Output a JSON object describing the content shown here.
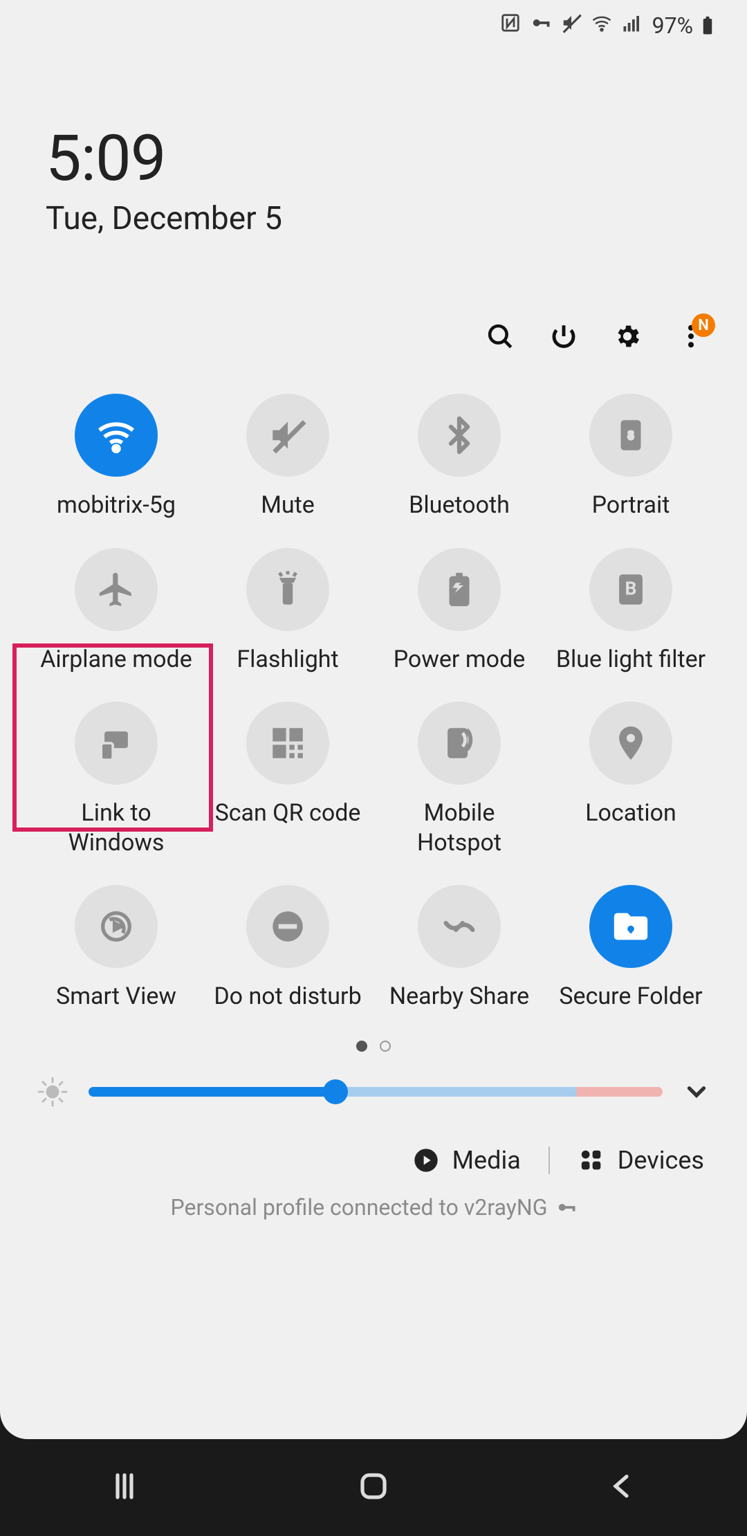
{
  "status": {
    "battery_pct": "97%",
    "icons": [
      "nfc",
      "vpn-key",
      "mute",
      "wifi",
      "signal",
      "battery"
    ]
  },
  "header": {
    "time": "5:09",
    "date": "Tue, December 5"
  },
  "actions": {
    "more_badge": "N"
  },
  "tiles": [
    {
      "id": "wifi",
      "label": "mobitrix-5g",
      "active": true
    },
    {
      "id": "mute",
      "label": "Mute",
      "active": false
    },
    {
      "id": "bluetooth",
      "label": "Bluetooth",
      "active": false
    },
    {
      "id": "portrait",
      "label": "Portrait",
      "active": false
    },
    {
      "id": "airplane",
      "label": "Airplane mode",
      "active": false,
      "highlighted": true
    },
    {
      "id": "flashlight",
      "label": "Flashlight",
      "active": false
    },
    {
      "id": "power-mode",
      "label": "Power mode",
      "active": false
    },
    {
      "id": "blue-light",
      "label": "Blue light filter",
      "active": false
    },
    {
      "id": "link-windows",
      "label": "Link to Windows",
      "active": false
    },
    {
      "id": "qr",
      "label": "Scan QR code",
      "active": false
    },
    {
      "id": "hotspot",
      "label": "Mobile Hotspot",
      "active": false
    },
    {
      "id": "location",
      "label": "Location",
      "active": false
    },
    {
      "id": "smart-view",
      "label": "Smart View",
      "active": false
    },
    {
      "id": "dnd",
      "label": "Do not disturb",
      "active": false
    },
    {
      "id": "nearby",
      "label": "Nearby Share",
      "active": false
    },
    {
      "id": "secure-folder",
      "label": "Secure Folder",
      "active": true
    }
  ],
  "pager": {
    "page_count": 2,
    "current": 0
  },
  "brightness": {
    "percent": 43
  },
  "extras": {
    "media_label": "Media",
    "devices_label": "Devices"
  },
  "footer": {
    "text": "Personal profile connected to v2rayNG"
  }
}
